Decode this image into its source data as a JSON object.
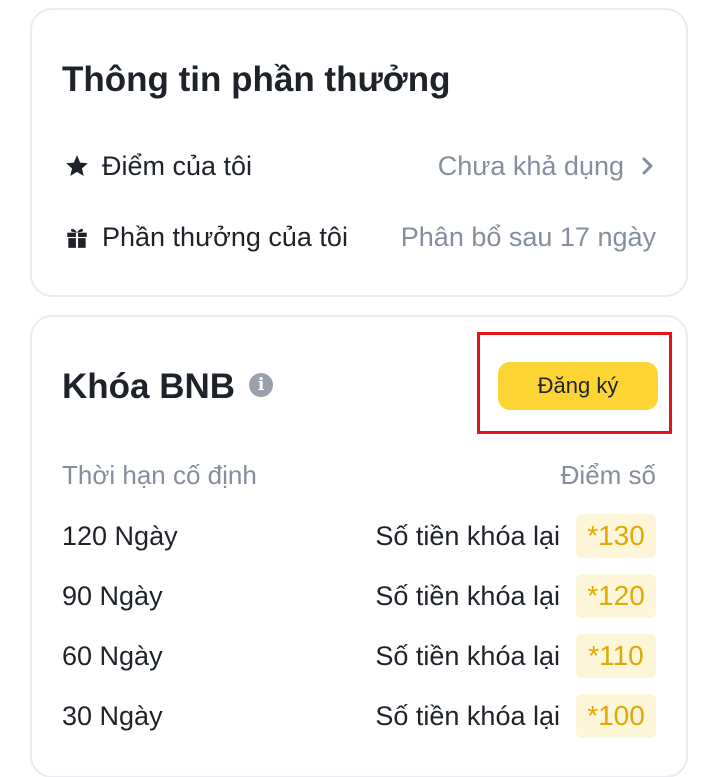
{
  "rewards_card": {
    "title": "Thông tin phần thưởng",
    "points_row": {
      "icon": "star-icon",
      "label": "Điểm của tôi",
      "value": "Chưa khả dụng",
      "chevron": "chevron-right-icon"
    },
    "rewards_row": {
      "icon": "gift-icon",
      "label": "Phần thưởng của tôi",
      "value": "Phân bổ sau 17 ngày"
    }
  },
  "lock_card": {
    "title": "Khóa BNB",
    "info_icon": "info-icon",
    "register_button": "Đăng ký",
    "table_header": {
      "left": "Thời hạn cố định",
      "right": "Điểm số"
    },
    "rows": [
      {
        "period": "120 Ngày",
        "desc": "Số tiền khóa lại",
        "points": "*130"
      },
      {
        "period": "90 Ngày",
        "desc": "Số tiền khóa lại",
        "points": "*120"
      },
      {
        "period": "60 Ngày",
        "desc": "Số tiền khóa lại",
        "points": "*110"
      },
      {
        "period": "30 Ngày",
        "desc": "Số tiền khóa lại",
        "points": "*100"
      }
    ]
  },
  "colors": {
    "accent_button": "#fcd535",
    "highlight_border": "#e0161e",
    "points_bg": "#fdf6d8",
    "points_text": "#e2a803",
    "muted_text": "#848e9c"
  }
}
